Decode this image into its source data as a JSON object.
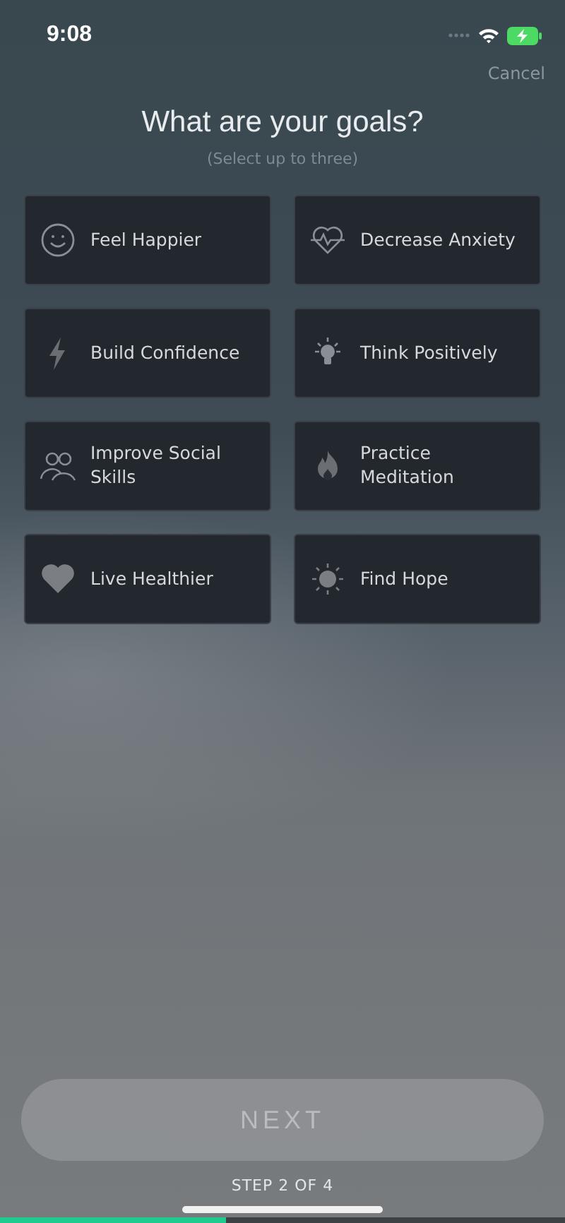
{
  "status_bar": {
    "time": "9:08"
  },
  "cancel": "Cancel",
  "title": "What are your goals?",
  "subtitle": "(Select up to three)",
  "goals": [
    {
      "label": "Feel Happier",
      "selected": false
    },
    {
      "label": "Decrease Anxiety",
      "selected": false
    },
    {
      "label": "Build Confidence",
      "selected": false
    },
    {
      "label": "Think Positively",
      "selected": false
    },
    {
      "label": "Improve Social Skills",
      "selected": false
    },
    {
      "label": "Practice Meditation",
      "selected": false
    },
    {
      "label": "Live Healthier",
      "selected": false
    },
    {
      "label": "Find Hope",
      "selected": false
    }
  ],
  "next_button": {
    "label": "NEXT",
    "disabled": true
  },
  "step": "STEP 2 OF 4",
  "progress": {
    "level": 0.4
  }
}
